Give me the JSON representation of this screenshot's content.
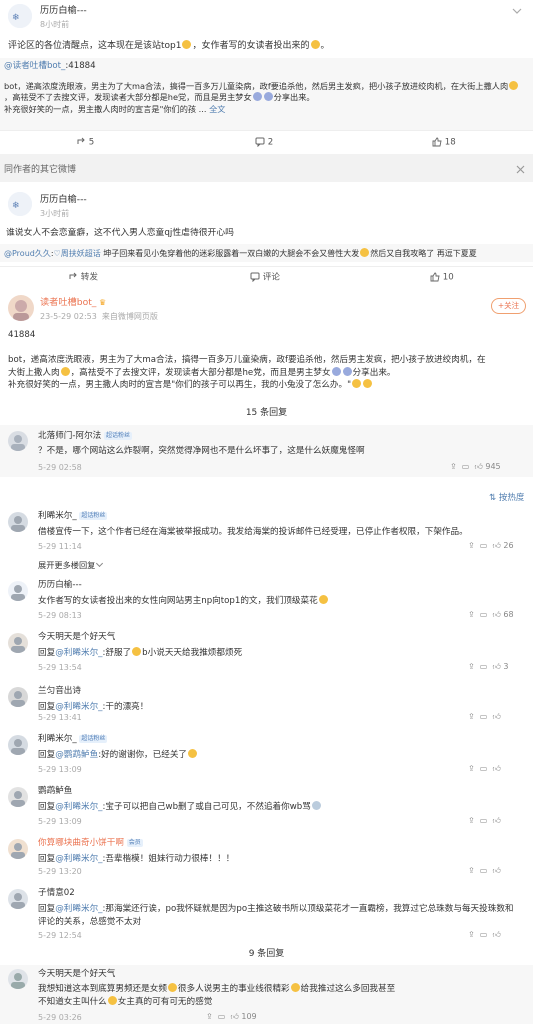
{
  "top_post": {
    "author": "历历白榆---",
    "time": "8小时前",
    "text_a": "评论区的各位清醒点，这本现在是该站top1",
    "text_b": "，女作者写的女读者投出来的",
    "text_c": "。",
    "quote_mention": "@读者吐槽bot_",
    "quote_suffix": ":41884",
    "quote_l1": "bot，递高浓度洗眼液，男主为了大ma合法，搞得一百多万儿童染病，政f要追杀他，然后男主发疯，把小孩子放进绞肉机，在大街上撒人肉",
    "quote_l2": "，高祛受不了去搜文评，发现读者大部分都是he党，而且是男主梦女",
    "quote_l2b": "分享出来。",
    "quote_l3": "补充很好笑的一点，男主撒人肉时的宣言是\"你们的孩 ...",
    "quote_more": "全文",
    "repost_count": "5",
    "comment_count": "2",
    "like_count": "18"
  },
  "section_label": "同作者的其它微博",
  "post2": {
    "author": "历历白榆---",
    "time": "3小时前",
    "text": "谁说女人不会恋童癖，这不代入男人恋童qj性虐待很开心吗",
    "quote_mention": "@Proud久久",
    "quote_tag": "周扶妖超话",
    "quote_text": "坤子回来看见小兔穿着他的迷彩服露着一双白嫩的大腿会不会又兽性大发",
    "quote_tail": "然后又自我攻略了 再逗下夏夏",
    "repost_label": "转发",
    "comment_label": "评论",
    "like_count": "10"
  },
  "main_post": {
    "author": "读者吐槽bot_",
    "time": "23-5-29 02:53",
    "source": "来自微博网页版",
    "follow": "+关注",
    "number": "41884",
    "p1": "bot，递高浓度洗眼液，男主为了大ma合法，搞得一百多万儿童染病，政f要追杀他，然后男主发疯，把小孩子放进绞肉机，在",
    "p2": "大街上撒人肉",
    "p2b": "，高祛受不了去搜文评，发现读者大部分都是he党，而且是男主梦女",
    "p2c": "分享出来。",
    "p3": "补充很好笑的一点，男主撒人肉时的宣言是\"你们的孩子可以再生，我的小兔没了怎么办。\""
  },
  "replies_15": "15 条回复",
  "first_reply": {
    "author": "北落师门-阿尔法",
    "badge": "超话粉丝",
    "text": "？不是，哪个网站这么炸裂啊，突然觉得净网也不是什么坏事了，这是什么妖魔鬼怪啊",
    "time": "5-29 02:58",
    "likes": "945"
  },
  "sort_label": "按热度",
  "comments": [
    {
      "author": "利晞米尔_",
      "badge": "超话粉丝",
      "prefix": "",
      "mention": "",
      "text": "借楼宣传一下，这个作者已经在海棠被举报成功。我发给海棠的投诉邮件已经受理，已停止作者权限，下架作品。",
      "time": "5-29 11:14",
      "likes": "26"
    },
    {
      "author": "历历白榆---",
      "badge": "",
      "prefix": "",
      "mention": "",
      "text": "女作者写的女读者投出来的女性向网站男主np向top1的文，我们顶级菜花",
      "time": "5-29 08:13",
      "likes": "68"
    },
    {
      "author": "今天明天是个好天气",
      "badge": "",
      "prefix": "回复",
      "mention": "@利晞米尔_",
      "text": ":舒服了",
      "text2": "b小说天天给我推烦都烦死",
      "time": "5-29 13:54",
      "likes": "3"
    },
    {
      "author": "兰匀音出诗",
      "badge": "",
      "prefix": "回复",
      "mention": "@利晞米尔_",
      "text": ":干的漂亮！",
      "time": "5-29 13:41",
      "likes": ""
    },
    {
      "author": "利晞米尔_",
      "badge": "超话粉丝",
      "prefix": "回复",
      "mention": "@鹦鹉鲈鱼",
      "text": ":好的谢谢你，已经关了",
      "time": "5-29 13:09",
      "likes": ""
    },
    {
      "author": "鹦鹉鲈鱼",
      "badge": "",
      "prefix": "回复",
      "mention": "@利晞米尔_",
      "text": ":宝子可以把自己wb删了或自己可见，不然追着你wb骂",
      "time": "5-29 13:09",
      "likes": ""
    },
    {
      "author": "你算哪块曲奇小饼干啊",
      "badge": "会员",
      "prefix": "回复",
      "mention": "@利晞米尔_",
      "text": ":吾辈楷模！姐妹行动力很棒！！！",
      "time": "5-29 13:20",
      "likes": ""
    },
    {
      "author": "子情意02",
      "badge": "",
      "prefix": "回复",
      "mention": "@利晞米尔_",
      "text": ":那海棠还行诶，po我怀疑就是因为po主推这破书所以顶级菜花才一直霸榜，我算过它总珠数与每天投珠数和评论的关系，总感觉不太对",
      "time": "5-29 12:54",
      "likes": ""
    }
  ],
  "expand_more": "展开更多楼回复",
  "replies_9": "9 条回复",
  "last_comment": {
    "author": "今天明天是个好天气",
    "text1": "我想知道这本到底算男频还是女频",
    "text1b": "很多人说男主的事业线很精彩",
    "text1c": "给我推过这么多回我甚至",
    "text2": "不知道女主叫什么",
    "text2b": "女主真的可有可无的感觉",
    "time": "5-29 03:26",
    "likes": "109"
  },
  "colors": {
    "link": "#507daf",
    "orange": "#eb7350",
    "emoji": "#f5c142"
  }
}
